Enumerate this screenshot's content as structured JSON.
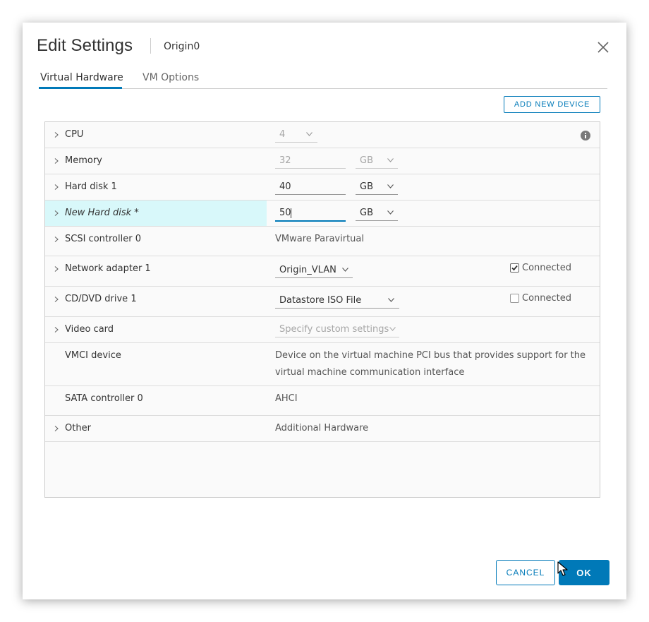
{
  "dialog": {
    "title": "Edit Settings",
    "subtitle": "Origin0"
  },
  "tabs": [
    {
      "label": "Virtual Hardware",
      "active": true
    },
    {
      "label": "VM Options",
      "active": false
    }
  ],
  "toolbar": {
    "add_device_label": "ADD NEW DEVICE"
  },
  "rows": {
    "cpu": {
      "label": "CPU",
      "value": "4"
    },
    "memory": {
      "label": "Memory",
      "value": "32",
      "unit": "GB"
    },
    "hard_disk_1": {
      "label": "Hard disk 1",
      "value": "40",
      "unit": "GB"
    },
    "new_hard_disk": {
      "label": "New Hard disk *",
      "value": "50",
      "unit": "GB"
    },
    "scsi": {
      "label": "SCSI controller 0",
      "value": "VMware Paravirtual"
    },
    "network": {
      "label": "Network adapter 1",
      "value": "Origin_VLAN",
      "connected_label": "Connected",
      "connected": true
    },
    "cddvd": {
      "label": "CD/DVD drive 1",
      "value": "Datastore ISO File",
      "connected_label": "Connected",
      "connected": false
    },
    "video": {
      "label": "Video card",
      "value": "Specify custom settings"
    },
    "vmci": {
      "label": "VMCI device",
      "value_line1": "Device on the virtual machine PCI bus that provides support for the",
      "value_line2": "virtual machine communication interface"
    },
    "sata": {
      "label": "SATA controller 0",
      "value": "AHCI"
    },
    "other": {
      "label": "Other",
      "value": "Additional Hardware"
    }
  },
  "footer": {
    "cancel_label": "CANCEL",
    "ok_label": "OK"
  },
  "colors": {
    "accent": "#0079b8",
    "highlight": "#d8f8fa"
  }
}
